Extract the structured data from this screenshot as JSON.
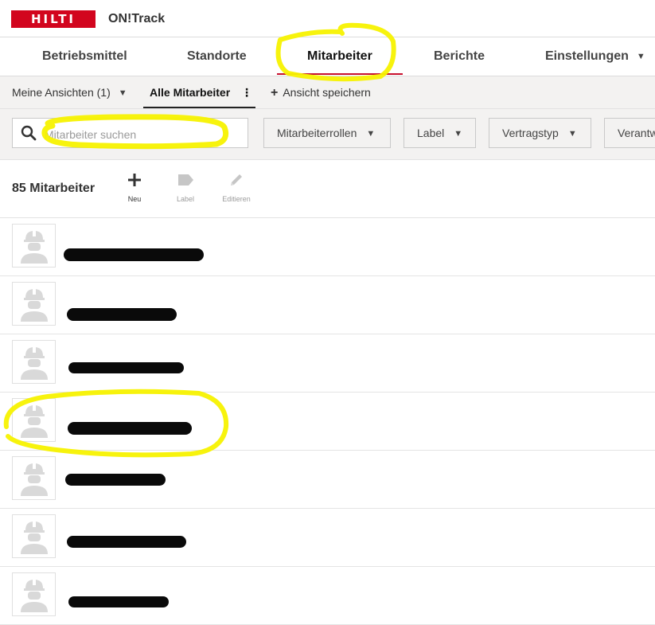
{
  "app": {
    "brand": "HILTI",
    "name": "ON!Track"
  },
  "nav": {
    "tabs": [
      {
        "label": "Betriebsmittel"
      },
      {
        "label": "Standorte"
      },
      {
        "label": "Mitarbeiter",
        "active": true
      },
      {
        "label": "Berichte"
      },
      {
        "label": "Einstellungen"
      }
    ]
  },
  "views": {
    "my_views": "Meine Ansichten (1)",
    "all_employees": "Alle Mitarbeiter",
    "save_view": "Ansicht speichern"
  },
  "filters": {
    "search_placeholder": "Mitarbeiter suchen",
    "roles": "Mitarbeiterrollen",
    "label": "Label",
    "contract": "Vertragstyp",
    "responsible": "Verantw"
  },
  "toolbar": {
    "count": "85 Mitarbeiter",
    "new": "Neu",
    "label": "Label",
    "edit": "Editieren"
  },
  "colors": {
    "brand_red": "#d2051e",
    "active_underline": "#c8102e",
    "highlighter": "#f7f200"
  },
  "employees": [
    {
      "redacted": true
    },
    {
      "redacted": true
    },
    {
      "redacted": true
    },
    {
      "redacted": true
    },
    {
      "redacted": true
    },
    {
      "redacted": true
    },
    {
      "redacted": true
    }
  ]
}
